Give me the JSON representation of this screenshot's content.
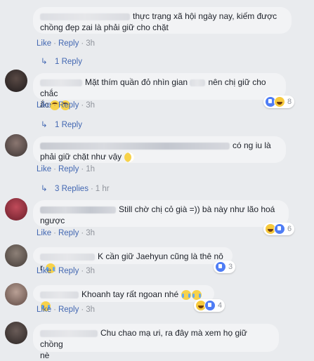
{
  "comments": [
    {
      "text": "thực trạng xã hội ngày nay, kiếm được chồng đẹp zai là phải giữ cho chặt",
      "line1": "thực trạng xã hội ngày nay, kiếm được",
      "line2": "chồng đẹp zai là phải giữ cho chặt",
      "time": "3h"
    },
    {
      "text": "Mặt thím quần đỏ nhìn gian nên chị giữ cho chắc ắc",
      "line1a": "Mặt thím quần đỏ nhìn gian",
      "line1b": "nên chị giữ cho chắc",
      "line2": "ắc",
      "time": "3h",
      "reactions": "8"
    },
    {
      "text": "có ng iu là phải giữ chặt như vậy",
      "line1": "có ng iu là",
      "line2": "phải giữ chặt như vậy",
      "time": "1h"
    },
    {
      "text": "Still chờ chị cỏ già =)) bà này như lão hoá ngược",
      "line1": "Still chờ chị cỏ già =)) bà này như lão hoá",
      "line2": "ngược",
      "time": "3h",
      "reactions": "6"
    },
    {
      "text": "K cần giữ Jaehyun cũng là thê nô r",
      "time": "3h",
      "reactions": "3"
    },
    {
      "text": "Khoanh tay rất ngoan nhé",
      "time": "3h",
      "reactions": "4"
    },
    {
      "text": "Chu chao mạ ưi, ra đây mà xem họ giữ chồng nè",
      "line1": "Chu chao mạ ưi, ra đây mà xem họ giữ chồng",
      "line2": "nè"
    }
  ],
  "actions": {
    "like": "Like",
    "reply": "Reply",
    "sep": "·"
  },
  "replies": [
    {
      "label": "1 Reply"
    },
    {
      "label": "1 Reply"
    },
    {
      "label": "3 Replies",
      "time": "1 hr"
    }
  ],
  "colors": {
    "link": "#4267b2",
    "meta": "#90949c",
    "bubble": "#f2f3f5",
    "background": "#e9ebee"
  }
}
